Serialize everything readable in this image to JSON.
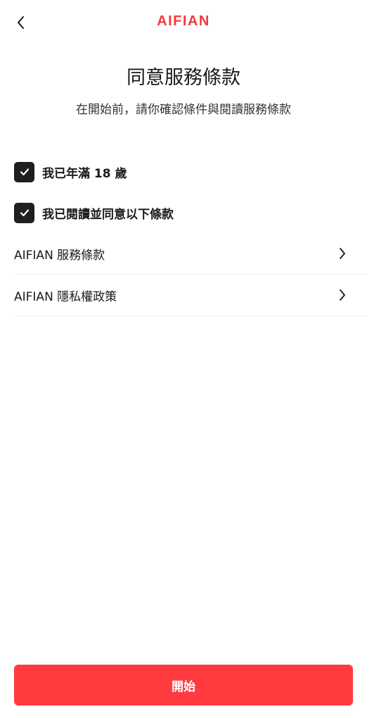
{
  "header": {
    "logo_text": "AIFIAN",
    "back_icon": "chevron-left-icon"
  },
  "intro": {
    "title": "同意服務條款",
    "subtitle": "在開始前，請你確認條件與閱讀服務條款"
  },
  "checkboxes": [
    {
      "label": "我已年滿 18 歲",
      "checked": true
    },
    {
      "label": "我已閱讀並同意以下條款",
      "checked": true
    }
  ],
  "links": [
    {
      "label": "AIFIAN 服務條款",
      "icon": "chevron-right-icon"
    },
    {
      "label": "AIFIAN 隱私權政策",
      "icon": "chevron-right-icon"
    }
  ],
  "footer": {
    "start_label": "開始"
  },
  "colors": {
    "brand": "#f03a3e",
    "checkbox": "#1f1f1f",
    "button": "#ff3b40"
  }
}
